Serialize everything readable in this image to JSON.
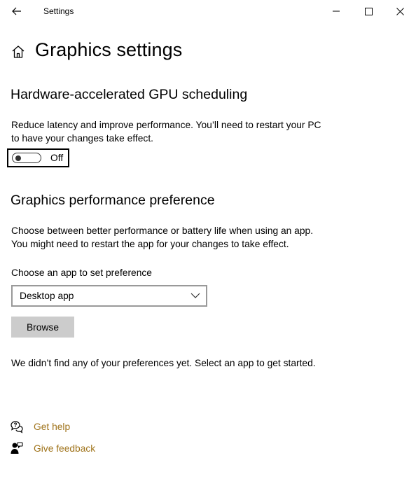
{
  "window": {
    "title": "Settings",
    "controls": [
      "minimize-icon",
      "maximize-icon",
      "close-icon"
    ]
  },
  "header": {
    "icon": "home-icon",
    "title": "Graphics settings"
  },
  "gpu_section": {
    "heading": "Hardware-accelerated GPU scheduling",
    "description": "Reduce latency and improve performance. You’ll need to restart your PC to have your changes take effect.",
    "toggle": {
      "state": "Off",
      "on": false
    }
  },
  "pref_section": {
    "heading": "Graphics performance preference",
    "description": "Choose between better performance or battery life when using an app. You might need to restart the app for your changes to take effect.",
    "field_label": "Choose an app to set preference",
    "dropdown_value": "Desktop app",
    "browse_label": "Browse",
    "empty_message": "We didn’t find any of your preferences yet. Select an app to get started."
  },
  "links": {
    "help": {
      "label": "Get help",
      "icon": "help-chat-icon"
    },
    "feedback": {
      "label": "Give feedback",
      "icon": "feedback-person-icon"
    }
  },
  "colors": {
    "link": "#a0741c",
    "button_bg": "#cccccc",
    "dropdown_border": "#999999"
  }
}
